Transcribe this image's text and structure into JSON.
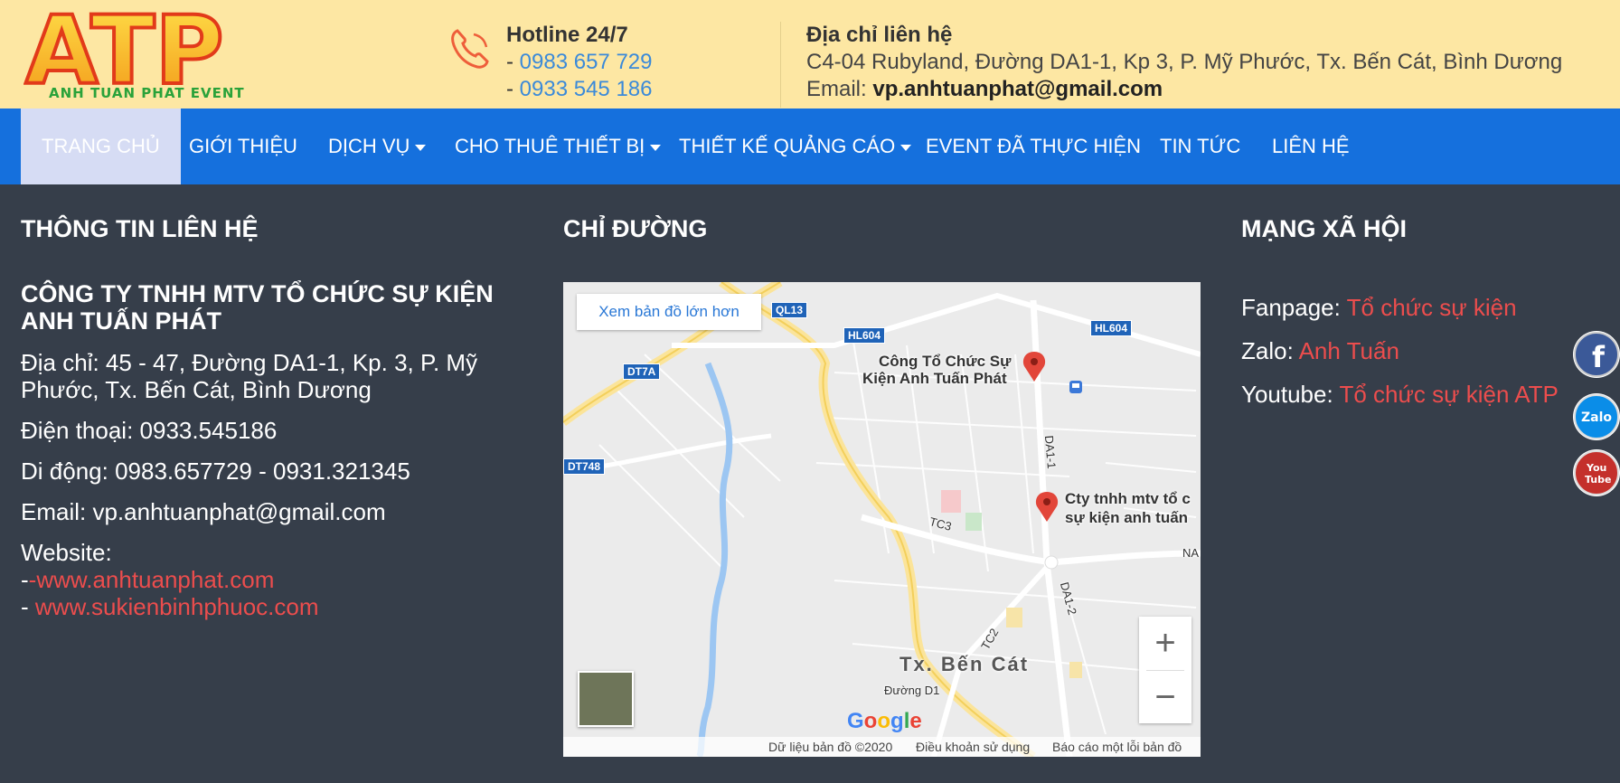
{
  "header": {
    "logo": {
      "text": "ANH TUAN PHAT EVENT",
      "letters": "ATP"
    },
    "hotline_title": "Hotline 24/7",
    "phones": [
      "0983 657 729",
      "0933 545 186"
    ],
    "address_title": "Địa chỉ liên hệ",
    "address": "C4-04 Rubyland, Đường DA1-1, Kp 3, P. Mỹ Phước, Tx. Bến Cát, Bình Dương",
    "email_label": "Email:",
    "email": "vp.anhtuanphat@gmail.com"
  },
  "nav": {
    "items": [
      "TRANG CHỦ",
      "GIỚI THIỆU",
      "DỊCH VỤ",
      "CHO THUÊ THIẾT BỊ",
      "THIẾT KẾ QUẢNG CÁO",
      "EVENT ĐÃ THỰC HIỆN",
      "TIN TỨC",
      "LIÊN HỆ"
    ]
  },
  "contact": {
    "title": "THÔNG TIN LIÊN HỆ",
    "company": "CÔNG TY TNHH MTV TỔ CHỨC SỰ KIỆN ANH TUẤN PHÁT",
    "address": "Địa chỉ: 45 - 47, Đường DA1-1, Kp. 3, P. Mỹ Phước, Tx. Bến Cát, Bình Dương",
    "phone": "Điện thoại: 0933.545186",
    "mobile": "Di động: 0983.657729 - 0931.321345",
    "email": "Email: vp.anhtuanphat@gmail.com",
    "website_label": "Website:",
    "website1_prefix": "-",
    "website1": "-www.anhtuanphat.com",
    "website2_prefix": "- ",
    "website2": "www.sukienbinhphuoc.com"
  },
  "map": {
    "title": "CHỈ ĐƯỜNG",
    "larger_map": "Xem bản đồ lớn hơn",
    "pin1": "Công Tổ Chức Sự Kiện Anh Tuấn Phát",
    "pin1_line1": "Công Tổ Chức Sự",
    "pin1_line2": "Kiện Anh Tuấn Phát",
    "pin2_line1": "Cty tnhh mtv tổ c",
    "pin2_line2": "sự kiện anh tuấn",
    "town": "Tx. Bến Cát",
    "roads": [
      "QL13",
      "HL604",
      "HL604",
      "DT7A",
      "DT748",
      "DA1-1",
      "TC3",
      "TC2",
      "DA1-2",
      "Đường D1",
      "NA"
    ],
    "google": "Google",
    "attribution": [
      "Dữ liệu bản đồ ©2020",
      "Điều khoản sử dụng",
      "Báo cáo một lỗi bản đồ"
    ]
  },
  "social": {
    "title": "MẠNG XÃ HỘI",
    "fanpage_label": "Fanpage: ",
    "fanpage": "Tổ chức sự kiện",
    "zalo_label": "Zalo: ",
    "zalo": "Anh Tuấn",
    "youtube_label": "Youtube: ",
    "youtube": "Tổ chức sự kiện ATP"
  },
  "floating": {
    "facebook": "f",
    "zalo": "Zalo",
    "youtube_line1": "You",
    "youtube_line2": "Tube"
  },
  "colors": {
    "topbar": "#fde7a3",
    "nav": "#1570dd",
    "footer": "#363e4a",
    "link_red": "#ec4d4d",
    "link_blue": "#3b8ad9"
  }
}
